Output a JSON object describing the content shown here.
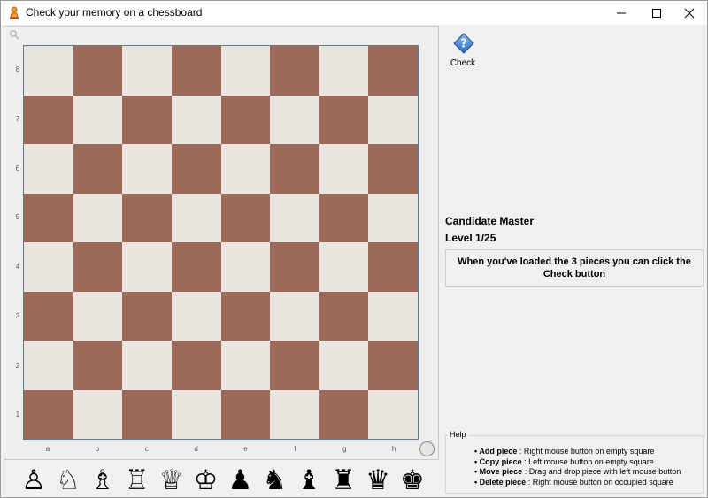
{
  "window": {
    "title": "Check your memory on a chessboard",
    "minimize_icon": "minimize-icon",
    "maximize_icon": "maximize-icon",
    "close_icon": "close-icon"
  },
  "board": {
    "ranks": [
      "8",
      "7",
      "6",
      "5",
      "4",
      "3",
      "2",
      "1"
    ],
    "files": [
      "a",
      "b",
      "c",
      "d",
      "e",
      "f",
      "g",
      "h"
    ],
    "light_color": "#eae6df",
    "dark_color": "#9c6a58"
  },
  "palette": {
    "pieces": [
      {
        "name": "white-pawn",
        "glyph": "♙"
      },
      {
        "name": "white-knight",
        "glyph": "♘"
      },
      {
        "name": "white-bishop",
        "glyph": "♗"
      },
      {
        "name": "white-rook",
        "glyph": "♖"
      },
      {
        "name": "white-queen",
        "glyph": "♕"
      },
      {
        "name": "white-king",
        "glyph": "♔"
      },
      {
        "name": "black-pawn",
        "glyph": "♟"
      },
      {
        "name": "black-knight",
        "glyph": "♞"
      },
      {
        "name": "black-bishop",
        "glyph": "♝"
      },
      {
        "name": "black-rook",
        "glyph": "♜"
      },
      {
        "name": "black-queen",
        "glyph": "♛"
      },
      {
        "name": "black-king",
        "glyph": "♚"
      }
    ]
  },
  "sidebar": {
    "check_label": "Check",
    "check_icon": "question-diamond-icon",
    "level_name": "Candidate Master",
    "level_count": "Level 1/25",
    "message": "When you've loaded the 3 pieces you can click the Check button"
  },
  "help": {
    "title": "Help",
    "items": [
      {
        "action": "Add piece",
        "description": " : Right mouse button on empty square"
      },
      {
        "action": "Copy piece",
        "description": " : Left mouse button on empty square"
      },
      {
        "action": "Move piece",
        "description": " : Drag and drop piece with left mouse button"
      },
      {
        "action": "Delete piece",
        "description": " : Right mouse button on occupied square"
      }
    ]
  }
}
